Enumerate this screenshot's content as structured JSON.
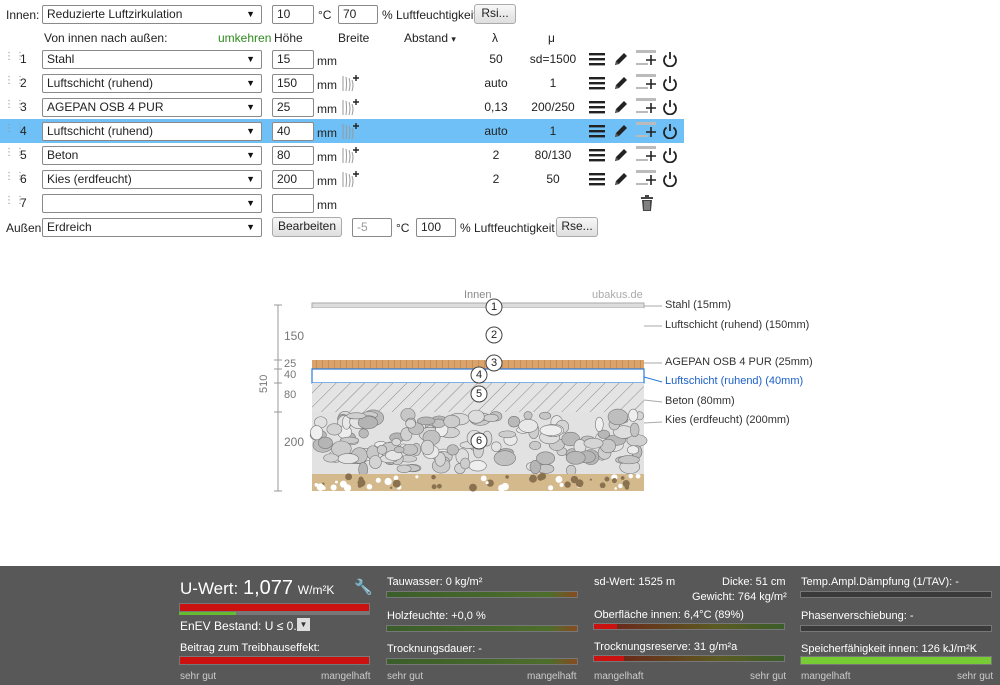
{
  "header": {
    "inner_label": "Innen:",
    "inner_select": "Reduzierte Luftzirkulation",
    "inner_temp": "10",
    "temp_unit": "°C",
    "inner_humidity": "70",
    "humidity_unit": "% Luftfeuchtigkeit",
    "rsi_button": "Rsi..."
  },
  "columns": {
    "direction": "Von innen nach außen:",
    "reverse": "umkehren",
    "height": "Höhe",
    "width": "Breite",
    "spacing": "Abstand",
    "spacing_arrow": "▾",
    "lambda": "λ",
    "mu": "μ"
  },
  "layers": [
    {
      "num": "1",
      "material": "Stahl",
      "thickness": "15",
      "unit": "mm",
      "lambda": "50",
      "mu": "sd=1500",
      "highlight": false
    },
    {
      "num": "2",
      "material": "Luftschicht (ruhend)",
      "thickness": "150",
      "unit": "mm",
      "lambda": "auto",
      "mu": "1",
      "highlight": false
    },
    {
      "num": "3",
      "material": "AGEPAN OSB 4 PUR",
      "thickness": "25",
      "unit": "mm",
      "lambda": "0,13",
      "mu": "200/250",
      "highlight": false
    },
    {
      "num": "4",
      "material": "Luftschicht (ruhend)",
      "thickness": "40",
      "unit": "mm",
      "lambda": "auto",
      "mu": "1",
      "highlight": true
    },
    {
      "num": "5",
      "material": "Beton",
      "thickness": "80",
      "unit": "mm",
      "lambda": "2",
      "mu": "80/130",
      "highlight": false
    },
    {
      "num": "6",
      "material": "Kies (erdfeucht)",
      "thickness": "200",
      "unit": "mm",
      "lambda": "2",
      "mu": "50",
      "highlight": false
    },
    {
      "num": "7",
      "material": "",
      "thickness": "",
      "unit": "mm",
      "lambda": "",
      "mu": "",
      "highlight": false
    }
  ],
  "outer": {
    "label": "Außen:",
    "select": "Erdreich",
    "edit_button": "Bearbeiten",
    "temp": "-5",
    "temp_unit": "°C",
    "humidity": "100",
    "humidity_unit": "% Luftfeuchtigkeit",
    "rse_button": "Rse..."
  },
  "diagram": {
    "inner_label": "Innen",
    "watermark": "ubakus.de",
    "total": "510",
    "dims": [
      "150",
      "25",
      "40",
      "80",
      "200"
    ],
    "labels": [
      {
        "num": "1",
        "text": "Stahl (15mm)",
        "active": false
      },
      {
        "num": "2",
        "text": "Luftschicht (ruhend) (150mm)",
        "active": false
      },
      {
        "num": "3",
        "text": "AGEPAN OSB 4 PUR (25mm)",
        "active": false
      },
      {
        "num": "4",
        "text": "Luftschicht (ruhend) (40mm)",
        "active": true
      },
      {
        "num": "5",
        "text": "Beton (80mm)",
        "active": false
      },
      {
        "num": "6",
        "text": "Kies (erdfeucht) (200mm)",
        "active": false
      }
    ],
    "active_color": "#1a5fc8"
  },
  "status": {
    "u_label": "U-Wert:",
    "u_value": "1,077",
    "u_unit": "W/m²K",
    "u_level": 1.0,
    "enev": "EnEV Bestand: U ≤ 0.3*",
    "greenhouse": "Beitrag zum Treibhauseffekt:",
    "greenhouse_level": 1.0,
    "scale_good": "sehr gut",
    "scale_bad": "mangelhaft",
    "tauwasser": "Tauwasser: 0 kg/m²",
    "holzfeuchte": "Holzfeuchte: +0,0 %",
    "trocknungsdauer": "Trocknungsdauer: -",
    "sd": "sd-Wert: 1525 m",
    "dicke": "Dicke: 51 cm",
    "gewicht": "Gewicht: 764 kg/m²",
    "oberflaeche": "Oberfläche innen: 6,4°C (89%)",
    "oberflaeche_level": 0.12,
    "trocknungsreserve": "Trocknungsreserve: 31 g/m²a",
    "trocknungsreserve_level": 0.16,
    "tav": "Temp.Ampl.Dämpfung (1/TAV): -",
    "phase": "Phasenverschiebung: -",
    "speicher": "Speicherfähigkeit innen: 126 kJ/m²K",
    "speicher_level": 1.0,
    "colors": {
      "bad": "#cc1111",
      "good": "#66bb33",
      "bg": "#585858"
    }
  }
}
